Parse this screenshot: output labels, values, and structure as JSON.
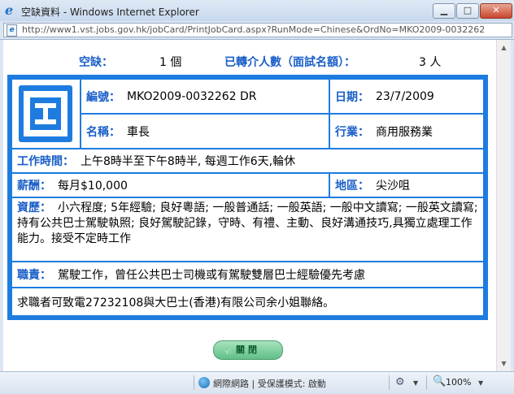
{
  "window": {
    "title": "空缺資料 - Windows Internet Explorer",
    "url": "http://www1.vst.jobs.gov.hk/jobCard/PrintJobCard.aspx?RunMode=Chinese&OrdNo=MKO2009-0032262"
  },
  "summary": {
    "vacancy_label": "空缺：",
    "vacancy_value": "1 個",
    "referred_label": "已轉介人數（面試名額）：",
    "referred_value": "3 人"
  },
  "job": {
    "order_no_label": "編號：",
    "order_no": "MKO2009-0032262 DR",
    "date_label": "日期：",
    "date": "23/7/2009",
    "title_label": "名稱：",
    "title": "車長",
    "industry_label": "行業：",
    "industry": "商用服務業",
    "hours_label": "工作時間：",
    "hours": "上午8時半至下午8時半, 每週工作6天,輪休",
    "salary_label": "薪酬：",
    "salary": "每月$10,000",
    "district_label": "地區：",
    "district": "尖沙咀",
    "qualifications_label": "資歷：",
    "qualifications": "小六程度; 5年經驗; 良好粵語; 一般普通話; 一般英語; 一般中文讀寫; 一般英文讀寫; 持有公共巴士駕駛執照; 良好駕駛記錄，守時、有禮、主動、良好溝通技巧,具獨立處理工作能力。接受不定時工作",
    "duties_label": "職責：",
    "duties": "駕駛工作，曾任公共巴士司機或有駕駛雙層巴士經驗優先考慮",
    "contact": "求職者可致電27232108與大巴士(香港)有限公司余小姐聯絡。"
  },
  "buttons": {
    "close_label": "關閉"
  },
  "statusbar": {
    "zone": "網際網路 | 受保護模式: 啟動",
    "zoom": "100%"
  },
  "colors": {
    "card_border": "#1e7ce0",
    "label_text": "#1a5fc8"
  }
}
